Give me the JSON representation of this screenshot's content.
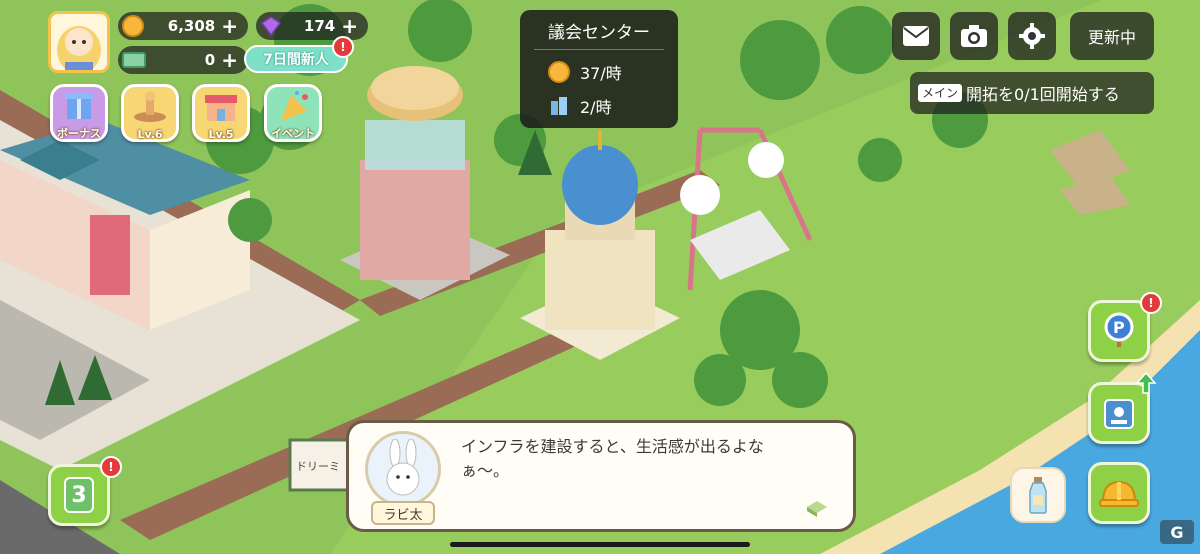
{
  "hud": {
    "coins": "6,308",
    "gems": "174",
    "tickets": "0",
    "new_player_label": "7日間新人",
    "badge_mark": "!"
  },
  "side_buttons": [
    {
      "label": "ボーナス"
    },
    {
      "label": "Lv.6"
    },
    {
      "label": "Lv.5"
    },
    {
      "label": "イベント"
    }
  ],
  "tooltip": {
    "title": "議会センター",
    "rows": [
      {
        "icon": "coin-icon",
        "value": "37/時"
      },
      {
        "icon": "building-icon",
        "value": "2/時"
      }
    ]
  },
  "top_right": {
    "update_label": "更新中"
  },
  "quest": {
    "tag": "メイン",
    "text": "開拓を0/1回開始する"
  },
  "dialog": {
    "text": "インフラを建設すると、生活感が出るよなぁ〜。",
    "speaker": "ラビ太"
  },
  "bottom_left": {
    "count": "3"
  },
  "sign_text": "ドリーミ",
  "colors": {
    "grass": "#8fc45a",
    "water": "#4aa8e0",
    "sand": "#f4e2b0",
    "accent_green": "#8fd146",
    "dark_panel": "#1e1e1e"
  }
}
